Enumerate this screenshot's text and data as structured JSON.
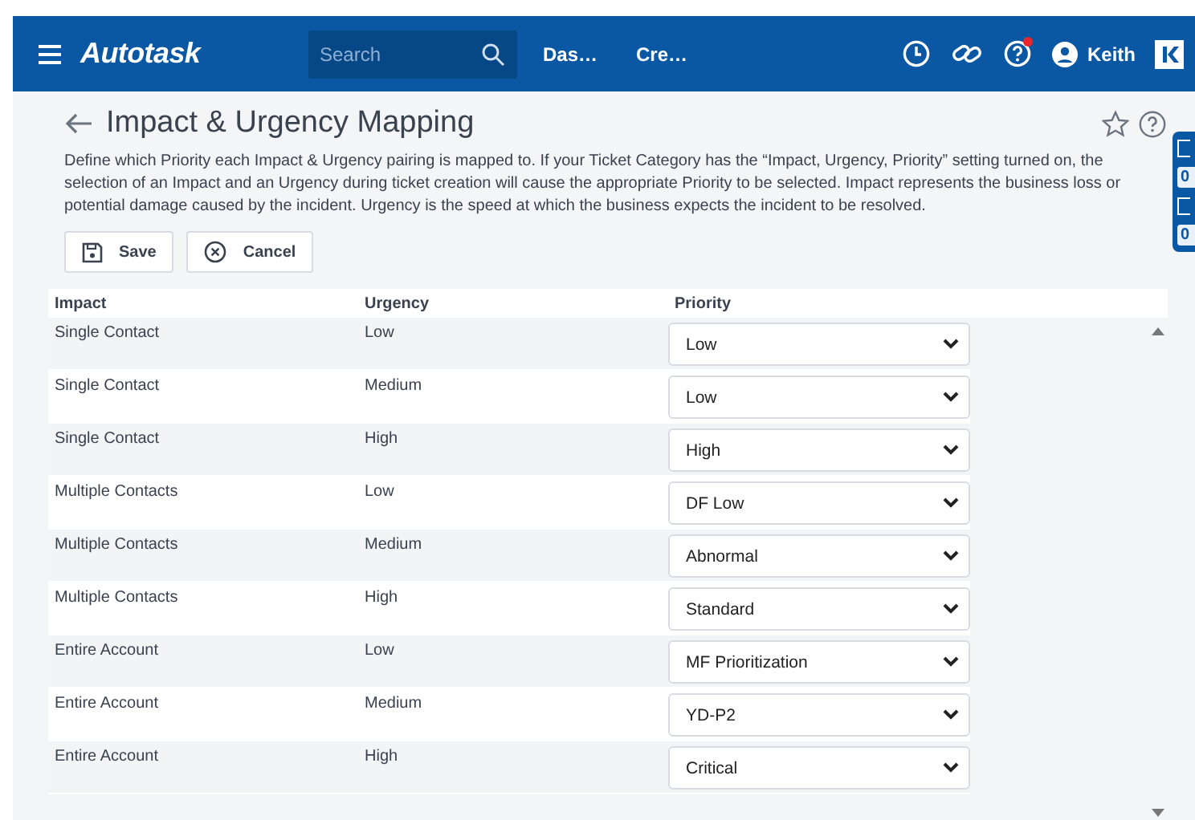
{
  "nav": {
    "logo": "Autotask",
    "search": {
      "placeholder": "Search"
    },
    "links": [
      "Das…",
      "Cre…"
    ],
    "help_notification": true,
    "user": "Keith"
  },
  "side_tab": {
    "counts": [
      "0",
      "0"
    ]
  },
  "page": {
    "title": "Impact & Urgency Mapping",
    "favorite": false,
    "description": "Define which Priority each Impact & Urgency pairing is mapped to. If your Ticket Category has the “Impact, Urgency, Priority” setting turned on, the selection of an Impact and an Urgency during ticket creation will cause the appropriate Priority to be selected. Impact represents the business loss or potential damage caused by the incident. Urgency is the speed at which the business expects the incident to be resolved.",
    "buttons": [
      {
        "kind": "save",
        "label": "Save"
      },
      {
        "kind": "cancel",
        "label": "Cancel"
      }
    ]
  },
  "table": {
    "columns": [
      "Impact",
      "Urgency",
      "Priority"
    ],
    "rows": [
      {
        "impact": "Single Contact",
        "urgency": "Low",
        "priority": "Low"
      },
      {
        "impact": "Single Contact",
        "urgency": "Medium",
        "priority": "Low"
      },
      {
        "impact": "Single Contact",
        "urgency": "High",
        "priority": "High"
      },
      {
        "impact": "Multiple Contacts",
        "urgency": "Low",
        "priority": "DF Low"
      },
      {
        "impact": "Multiple Contacts",
        "urgency": "Medium",
        "priority": "Abnormal"
      },
      {
        "impact": "Multiple Contacts",
        "urgency": "High",
        "priority": "Standard"
      },
      {
        "impact": "Entire Account",
        "urgency": "Low",
        "priority": "MF Prioritization"
      },
      {
        "impact": "Entire Account",
        "urgency": "Medium",
        "priority": "YD-P2"
      },
      {
        "impact": "Entire Account",
        "urgency": "High",
        "priority": "Critical"
      }
    ]
  }
}
